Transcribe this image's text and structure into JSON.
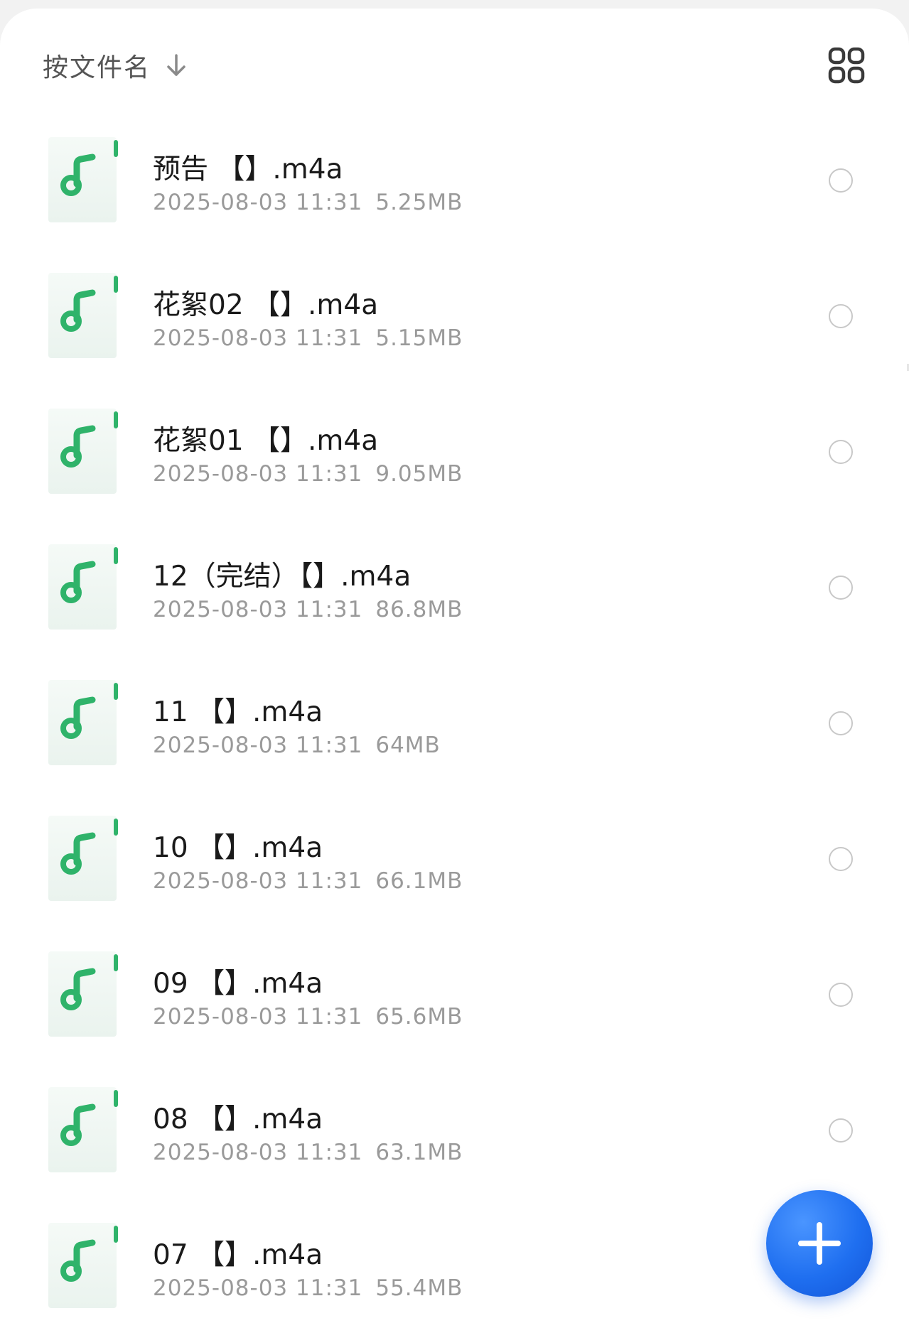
{
  "toolbar": {
    "sort_label": "按文件名",
    "sort_icon": "arrow-down-icon",
    "view_icon": "grid-view-icon"
  },
  "colors": {
    "accent_green": "#2fb36a",
    "fab_blue": "#1f6ff0"
  },
  "files": [
    {
      "name": "预告 【】.m4a",
      "date": "2025-08-03 11:31",
      "size": "5.25MB",
      "icon": "audio-file-icon"
    },
    {
      "name": "花絮02 【】.m4a",
      "date": "2025-08-03 11:31",
      "size": "5.15MB",
      "icon": "audio-file-icon"
    },
    {
      "name": "花絮01 【】.m4a",
      "date": "2025-08-03 11:31",
      "size": "9.05MB",
      "icon": "audio-file-icon"
    },
    {
      "name": "12（完结）【】.m4a",
      "date": "2025-08-03 11:31",
      "size": "86.8MB",
      "icon": "audio-file-icon"
    },
    {
      "name": "11 【】.m4a",
      "date": "2025-08-03 11:31",
      "size": "64MB",
      "icon": "audio-file-icon"
    },
    {
      "name": "10 【】.m4a",
      "date": "2025-08-03 11:31",
      "size": "66.1MB",
      "icon": "audio-file-icon"
    },
    {
      "name": "09 【】.m4a",
      "date": "2025-08-03 11:31",
      "size": "65.6MB",
      "icon": "audio-file-icon"
    },
    {
      "name": "08 【】.m4a",
      "date": "2025-08-03 11:31",
      "size": "63.1MB",
      "icon": "audio-file-icon"
    },
    {
      "name": "07 【】.m4a",
      "date": "2025-08-03 11:31",
      "size": "55.4MB",
      "icon": "audio-file-icon"
    }
  ],
  "fab": {
    "icon": "plus-icon"
  }
}
